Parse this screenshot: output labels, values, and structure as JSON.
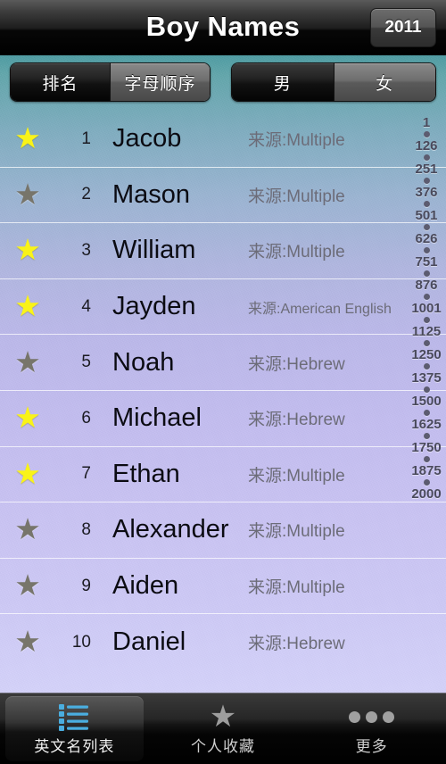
{
  "titlebar": {
    "title": "Boy Names",
    "year_button": "2011"
  },
  "filters": {
    "sort": {
      "options": [
        "排名",
        "字母顺序"
      ],
      "selected": "排名"
    },
    "gender": {
      "options": [
        "男",
        "女"
      ],
      "selected": "男"
    }
  },
  "list": {
    "source_prefix": "来源:",
    "rows": [
      {
        "rank": "1",
        "name": "Jacob",
        "source": "来源:Multiple",
        "favorite": true,
        "star": "★"
      },
      {
        "rank": "2",
        "name": "Mason",
        "source": "来源:Multiple",
        "favorite": false,
        "star": "★"
      },
      {
        "rank": "3",
        "name": "William",
        "source": "来源:Multiple",
        "favorite": true,
        "star": "★"
      },
      {
        "rank": "4",
        "name": "Jayden",
        "source": "来源:American English",
        "favorite": true,
        "star": "★"
      },
      {
        "rank": "5",
        "name": "Noah",
        "source": "来源:Hebrew",
        "favorite": false,
        "star": "★"
      },
      {
        "rank": "6",
        "name": "Michael",
        "source": "来源:Hebrew",
        "favorite": true,
        "star": "★"
      },
      {
        "rank": "7",
        "name": "Ethan",
        "source": "来源:Multiple",
        "favorite": true,
        "star": "★"
      },
      {
        "rank": "8",
        "name": "Alexander",
        "source": "来源:Multiple",
        "favorite": false,
        "star": "★"
      },
      {
        "rank": "9",
        "name": "Aiden",
        "source": "来源:Multiple",
        "favorite": false,
        "star": "★"
      },
      {
        "rank": "10",
        "name": "Daniel",
        "source": "来源:Hebrew",
        "favorite": false,
        "star": "★"
      }
    ]
  },
  "index_bar": {
    "labels": [
      "1",
      "126",
      "251",
      "376",
      "501",
      "626",
      "751",
      "876",
      "1001",
      "1125",
      "1250",
      "1375",
      "1500",
      "1625",
      "1750",
      "1875",
      "2000"
    ]
  },
  "tabbar": {
    "tabs": [
      {
        "label": "英文名列表",
        "icon": "list-icon",
        "active": true
      },
      {
        "label": "个人收藏",
        "icon": "star-icon",
        "active": false,
        "glyph": "★"
      },
      {
        "label": "更多",
        "icon": "more-dots-icon",
        "active": false
      }
    ]
  },
  "colors": {
    "favorite_star": "#f9f318",
    "inactive_star": "#77756b",
    "tab_icon_blue": "#4aaee0",
    "background_top": "#4d9ba2",
    "background_bottom": "#d4d2fa"
  }
}
